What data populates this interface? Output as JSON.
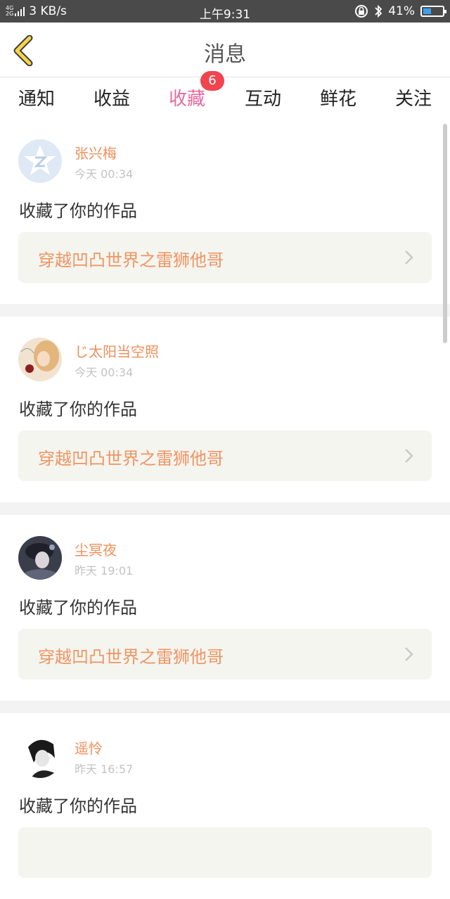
{
  "status_bar": {
    "network": "4G",
    "network2": "2G",
    "speed": "3 KB/s",
    "time": "上午9:31",
    "battery": "41%",
    "battery_level": 0.41
  },
  "header": {
    "title": "消息"
  },
  "tabs": [
    {
      "label": "通知"
    },
    {
      "label": "收益"
    },
    {
      "label": "收藏",
      "active": true,
      "badge": "6"
    },
    {
      "label": "互动"
    },
    {
      "label": "鲜花"
    },
    {
      "label": "关注"
    }
  ],
  "messages": [
    {
      "user": "张兴梅",
      "time": "今天 00:34",
      "action": "收藏了你的作品",
      "work": "穿越凹凸世界之雷狮他哥"
    },
    {
      "user": "じ太阳当空照",
      "time": "今天 00:34",
      "action": "收藏了你的作品",
      "work": "穿越凹凸世界之雷狮他哥"
    },
    {
      "user": "尘冥夜",
      "time": "昨天 19:01",
      "action": "收藏了你的作品",
      "work": "穿越凹凸世界之雷狮他哥"
    },
    {
      "user": "遥怜",
      "time": "昨天 16:57",
      "action": "收藏了你的作品",
      "work": ""
    }
  ],
  "colors": {
    "accent_pink": "#e86a9d",
    "name_orange": "#ef8f5a",
    "badge_red": "#f0454f"
  }
}
